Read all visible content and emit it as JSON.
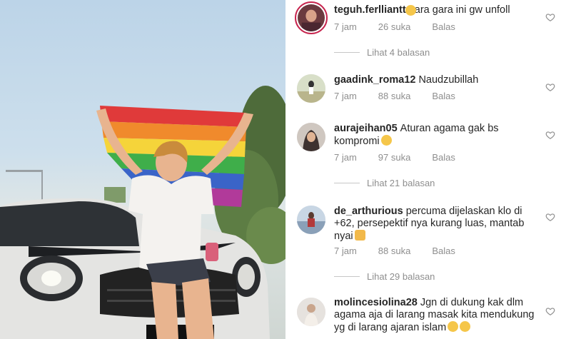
{
  "comments": [
    {
      "username": "teguh.ferlliantt",
      "text": "gara gara ini gw unfoll",
      "emoji": "pleading-face-emoji",
      "time": "7 jam",
      "likes": "26 suka",
      "reply": "Balas",
      "replies": "Lihat 4 balasan"
    },
    {
      "username": "gaadink_roma12",
      "text": "Naudzubillah",
      "time": "7 jam",
      "likes": "88 suka",
      "reply": "Balas"
    },
    {
      "username": "aurajeihan05",
      "text": "Aturan agama gak bs kompromi",
      "emoji": "smiling-face-emoji",
      "time": "7 jam",
      "likes": "97 suka",
      "reply": "Balas",
      "replies": "Lihat 21 balasan"
    },
    {
      "username": "de_arthurious",
      "text": "percuma dijelaskan klo di +62, persepektif nya kurang luas, mantab nyai",
      "emoji": "clapping-hands-emoji",
      "time": "7 jam",
      "likes": "88 suka",
      "reply": "Balas",
      "replies": "Lihat 29 balasan"
    },
    {
      "username": "molincesiolina28",
      "text": "Jgn di dukung kak dlm agama aja di larang masak kita mendukung yg di larang ajaran islam",
      "emoji": "pleading-face-emoji"
    }
  ],
  "colors": {
    "text": "#262626",
    "muted": "#8e8e8e",
    "story_ring": "#c7254e",
    "flag": [
      "#e03a3a",
      "#f08a2c",
      "#f5d43a",
      "#3fae4a",
      "#3a64c8",
      "#7a3aa0"
    ]
  },
  "icons": [
    "heart-outline-icon"
  ]
}
